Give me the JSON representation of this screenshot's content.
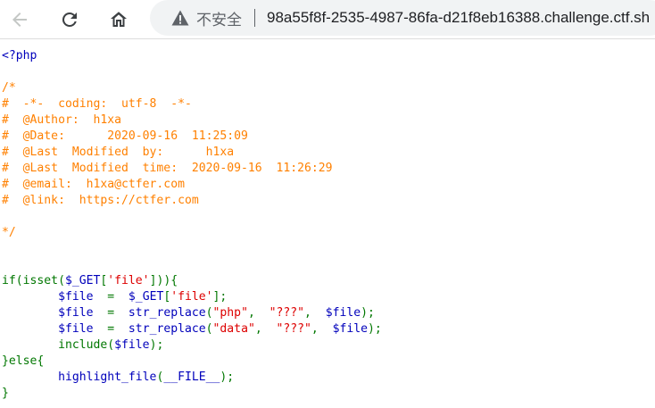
{
  "browser": {
    "security_label": "不安全",
    "url": "98a55f8f-2535-4987-86fa-d21f8eb16388.challenge.ctf.sh"
  },
  "source": {
    "lines": [
      [
        {
          "t": "<?php",
          "c": "default"
        }
      ],
      [],
      [
        {
          "t": "/*",
          "c": "comment"
        }
      ],
      [
        {
          "t": "#  -*-  coding:  utf-8  -*-",
          "c": "comment"
        }
      ],
      [
        {
          "t": "#  @Author:  h1xa",
          "c": "comment"
        }
      ],
      [
        {
          "t": "#  @Date:      2020-09-16  11:25:09",
          "c": "comment"
        }
      ],
      [
        {
          "t": "#  @Last  Modified  by:      h1xa",
          "c": "comment"
        }
      ],
      [
        {
          "t": "#  @Last  Modified  time:  2020-09-16  11:26:29",
          "c": "comment"
        }
      ],
      [
        {
          "t": "#  @email:  h1xa@ctfer.com",
          "c": "comment"
        }
      ],
      [
        {
          "t": "#  @link:  https://ctfer.com",
          "c": "comment"
        }
      ],
      [],
      [
        {
          "t": "*/",
          "c": "comment"
        }
      ],
      [],
      [],
      [
        {
          "t": "if(isset(",
          "c": "keyword"
        },
        {
          "t": "$_GET",
          "c": "default"
        },
        {
          "t": "[",
          "c": "keyword"
        },
        {
          "t": "'file'",
          "c": "string"
        },
        {
          "t": "])){",
          "c": "keyword"
        }
      ],
      [
        {
          "t": "        ",
          "c": "keyword"
        },
        {
          "t": "$file  ",
          "c": "default"
        },
        {
          "t": "=  ",
          "c": "keyword"
        },
        {
          "t": "$_GET",
          "c": "default"
        },
        {
          "t": "[",
          "c": "keyword"
        },
        {
          "t": "'file'",
          "c": "string"
        },
        {
          "t": "];",
          "c": "keyword"
        }
      ],
      [
        {
          "t": "        ",
          "c": "keyword"
        },
        {
          "t": "$file  ",
          "c": "default"
        },
        {
          "t": "=  ",
          "c": "keyword"
        },
        {
          "t": "str_replace",
          "c": "default"
        },
        {
          "t": "(",
          "c": "keyword"
        },
        {
          "t": "\"php\"",
          "c": "string"
        },
        {
          "t": ",  ",
          "c": "keyword"
        },
        {
          "t": "\"???\"",
          "c": "string"
        },
        {
          "t": ",  ",
          "c": "keyword"
        },
        {
          "t": "$file",
          "c": "default"
        },
        {
          "t": ");",
          "c": "keyword"
        }
      ],
      [
        {
          "t": "        ",
          "c": "keyword"
        },
        {
          "t": "$file  ",
          "c": "default"
        },
        {
          "t": "=  ",
          "c": "keyword"
        },
        {
          "t": "str_replace",
          "c": "default"
        },
        {
          "t": "(",
          "c": "keyword"
        },
        {
          "t": "\"data\"",
          "c": "string"
        },
        {
          "t": ",  ",
          "c": "keyword"
        },
        {
          "t": "\"???\"",
          "c": "string"
        },
        {
          "t": ",  ",
          "c": "keyword"
        },
        {
          "t": "$file",
          "c": "default"
        },
        {
          "t": ");",
          "c": "keyword"
        }
      ],
      [
        {
          "t": "        include(",
          "c": "keyword"
        },
        {
          "t": "$file",
          "c": "default"
        },
        {
          "t": ");",
          "c": "keyword"
        }
      ],
      [
        {
          "t": "}else{",
          "c": "keyword"
        }
      ],
      [
        {
          "t": "        ",
          "c": "keyword"
        },
        {
          "t": "highlight_file",
          "c": "default"
        },
        {
          "t": "(",
          "c": "keyword"
        },
        {
          "t": "__FILE__",
          "c": "default"
        },
        {
          "t": ");",
          "c": "keyword"
        }
      ],
      [
        {
          "t": "}",
          "c": "keyword"
        }
      ]
    ]
  },
  "icons": {
    "back": "arrow-left-icon",
    "reload": "reload-icon",
    "home": "home-icon",
    "security": "warning-triangle-icon"
  },
  "colors": {
    "default": "#0000bb",
    "comment": "#ff8000",
    "keyword": "#007700",
    "string": "#dd0000"
  }
}
